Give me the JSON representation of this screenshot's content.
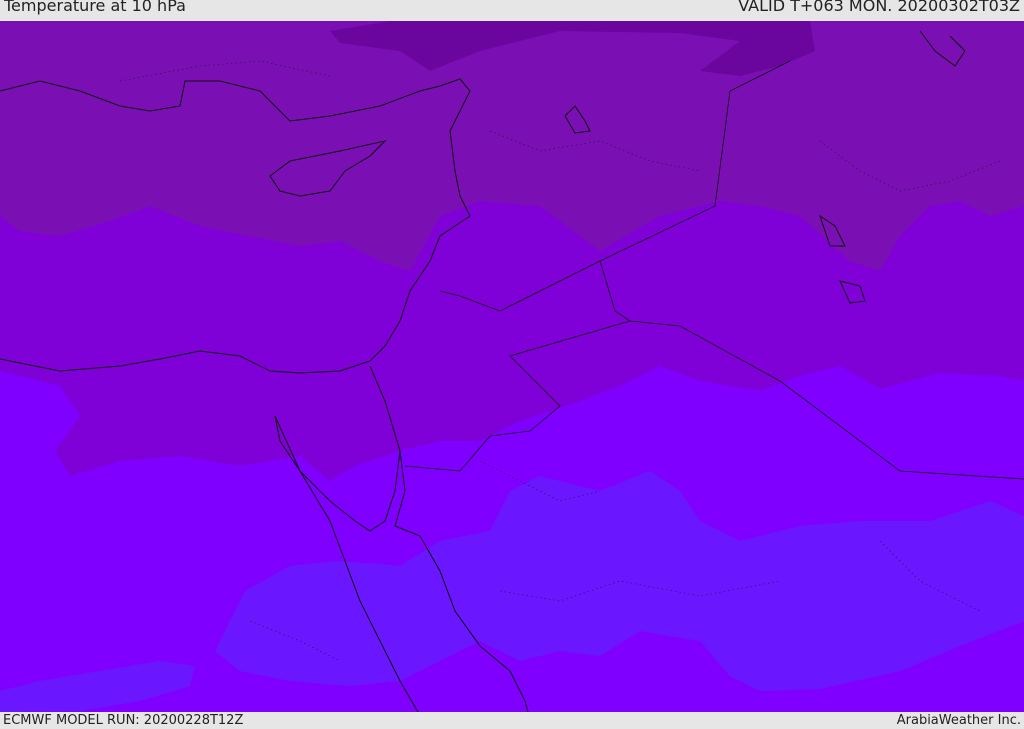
{
  "header": {
    "title": "Temperature at 10 hPa",
    "valid": "VALID T+063 MON. 20200302T03Z"
  },
  "footer": {
    "model_run": "ECMWF MODEL RUN: 20200228T12Z",
    "credit": "ArabiaWeather Inc."
  },
  "map": {
    "colors": {
      "darkest": "#6a059e",
      "dark": "#7a10b4",
      "mid": "#8000d8",
      "light": "#8000ff",
      "blue": "#6a17ff",
      "border": "#111111"
    }
  }
}
